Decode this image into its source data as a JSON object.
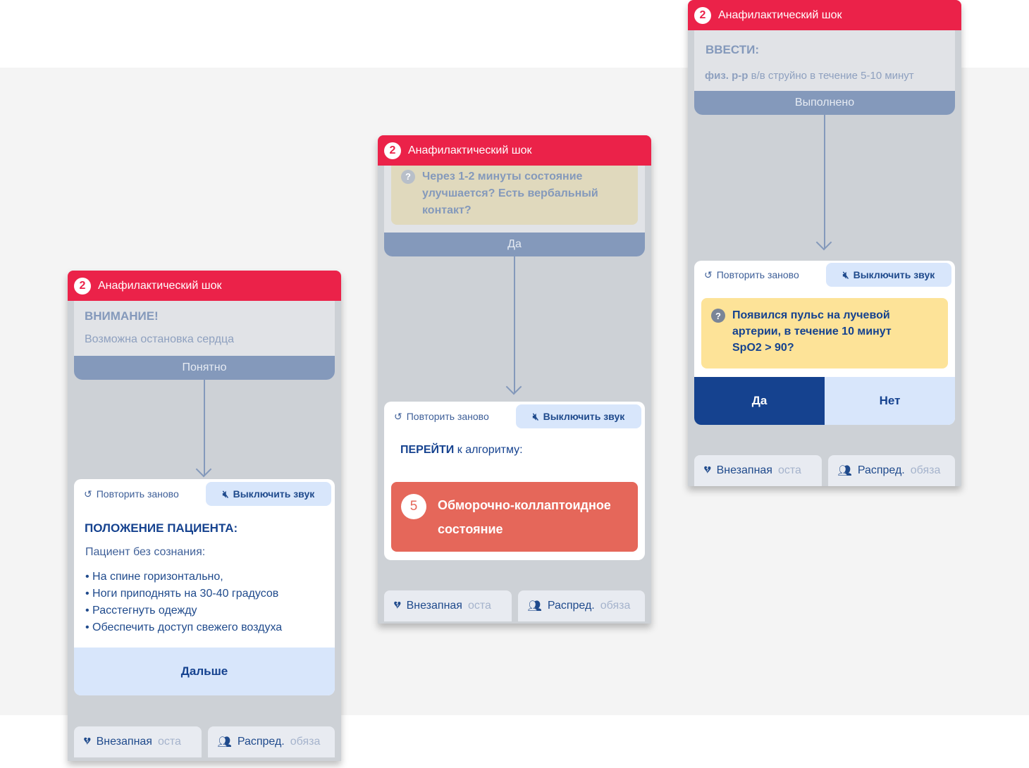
{
  "header": {
    "number": "2",
    "title": "Анафилактический шок"
  },
  "toolbar": {
    "repeat_label": "Повторить заново",
    "mute_label": "Выключить звук"
  },
  "tabs": [
    {
      "label": "Внезапная ",
      "label_faded": "оста",
      "icon": "broken-heart-icon"
    },
    {
      "label": "Распред. ",
      "label_faded": "обяза",
      "icon": "people-icon"
    }
  ],
  "colors": {
    "header": "#eb2249",
    "primary": "#15428f",
    "light": "#d8e6fb",
    "question": "#fde398",
    "algorithm": "#e5675a"
  },
  "left": {
    "prev": {
      "title": "ВНИМАНИЕ!",
      "text": "Возможна остановка сердца",
      "button": "Понятно"
    },
    "current": {
      "title": "ПОЛОЖЕНИЕ ПАЦИЕНТА:",
      "subtitle": "Пациент без сознания:",
      "items": [
        "На спине горизонтально,",
        "Ноги приподнять на 30-40 градусов",
        "Расстегнуть одежду",
        "Обеспечить доступ свежего воздуха"
      ],
      "button": "Дальше"
    }
  },
  "middle": {
    "prev": {
      "question": "Через 1-2 минуты состояние улучшается? Есть вербальный контакт?",
      "button": "Да"
    },
    "current": {
      "goto_bold": "ПЕРЕЙТИ",
      "goto_text": " к алгоритму:",
      "algorithm_number": "5",
      "algorithm_title": "Обморочно-коллаптоидное состояние"
    }
  },
  "right": {
    "prev": {
      "title": "ВВЕСТИ:",
      "text_bold": "физ. р-р",
      "text": " в/в струйно в течение 5-10 минут",
      "button": "Выполнено"
    },
    "current": {
      "question": "Появился пульс на лучевой артерии, в течение 10 минут SpO2 > 90?",
      "yes": "Да",
      "no": "Нет"
    }
  }
}
